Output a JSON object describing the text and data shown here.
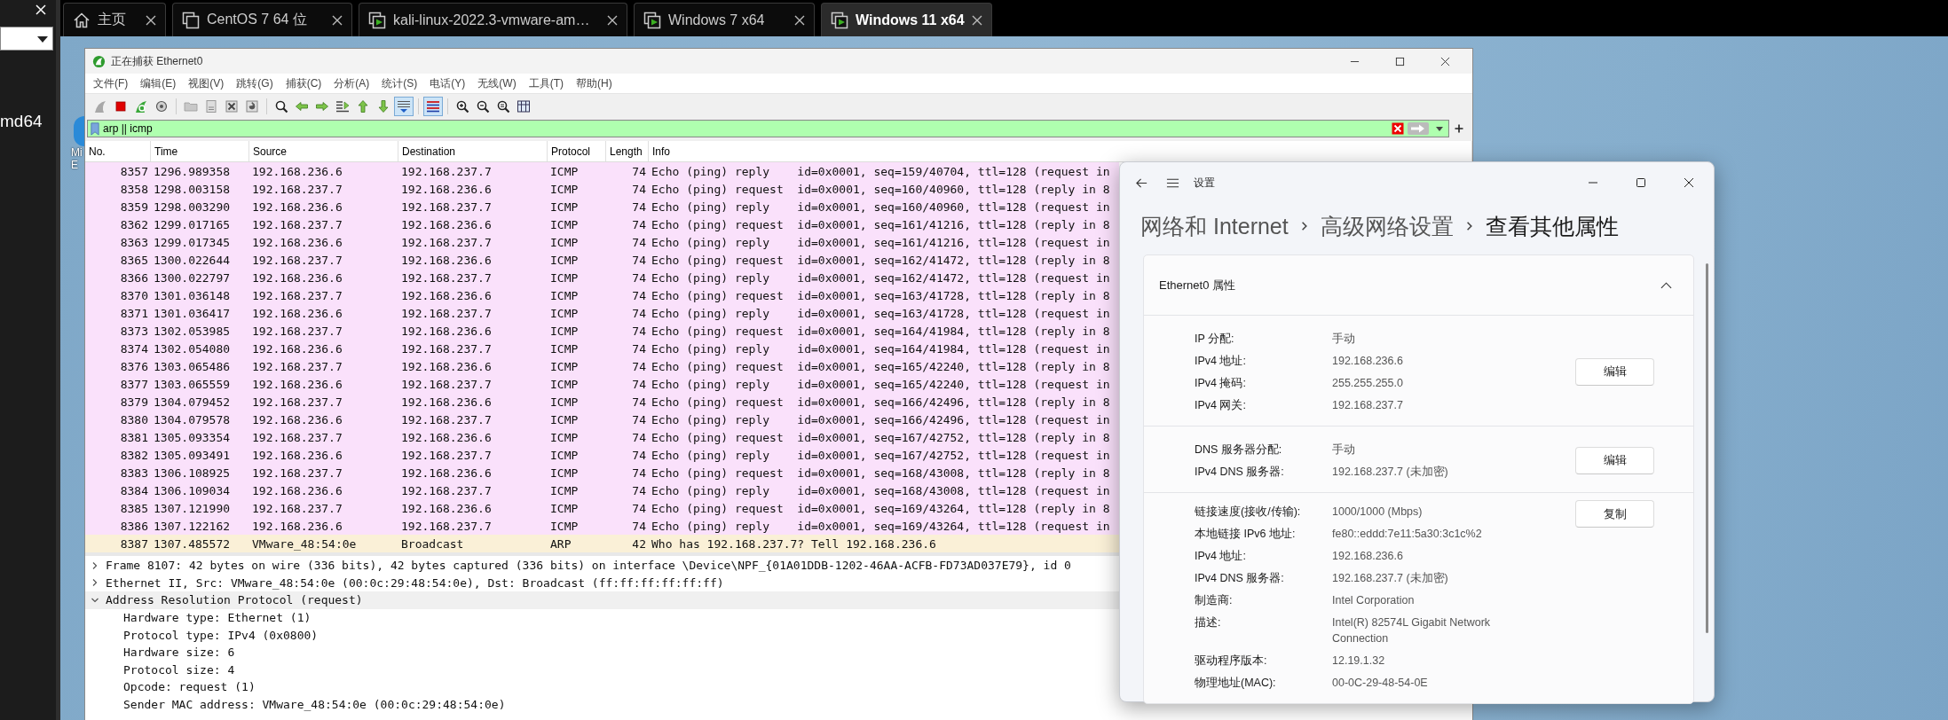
{
  "left_panel": {
    "label": "md64"
  },
  "browser_tabs": [
    {
      "label": "主页",
      "kind": "home",
      "selected": false
    },
    {
      "label": "CentOS 7 64 位",
      "kind": "vm",
      "selected": false
    },
    {
      "label": "kali-linux-2022.3-vmware-am…",
      "kind": "vm-running",
      "selected": false
    },
    {
      "label": "Windows 7 x64",
      "kind": "vm-running",
      "selected": false
    },
    {
      "label": "Windows 11 x64",
      "kind": "vm-running",
      "selected": true
    }
  ],
  "desktop_icon": {
    "label_lines": [
      "Mi",
      "E"
    ]
  },
  "wireshark": {
    "title": "正在捕获 Ethernet0",
    "menu": [
      "文件(F)",
      "编辑(E)",
      "视图(V)",
      "跳转(G)",
      "捕获(C)",
      "分析(A)",
      "统计(S)",
      "电话(Y)",
      "无线(W)",
      "工具(T)",
      "帮助(H)"
    ],
    "toolbar_buttons": [
      {
        "kind": "fin",
        "pressed": false
      },
      {
        "kind": "stop",
        "pressed": false
      },
      {
        "kind": "restart",
        "pressed": false
      },
      {
        "kind": "options",
        "pressed": false
      },
      {
        "kind": "open",
        "pressed": false
      },
      {
        "kind": "save",
        "pressed": false
      },
      {
        "kind": "close",
        "pressed": false
      },
      {
        "kind": "reload",
        "pressed": false
      },
      {
        "kind": "find",
        "pressed": false
      },
      {
        "kind": "back",
        "pressed": false
      },
      {
        "kind": "forward",
        "pressed": false
      },
      {
        "kind": "jump",
        "pressed": false
      },
      {
        "kind": "first",
        "pressed": false
      },
      {
        "kind": "last",
        "pressed": false
      },
      {
        "kind": "autoscroll",
        "pressed": true
      },
      {
        "kind": "colorize",
        "pressed": true
      },
      {
        "kind": "zoom-in",
        "pressed": false
      },
      {
        "kind": "zoom-out",
        "pressed": false
      },
      {
        "kind": "zoom-reset",
        "pressed": false
      },
      {
        "kind": "resize",
        "pressed": false
      }
    ],
    "filter": {
      "value": "arp || icmp"
    },
    "packet_list": {
      "columns": [
        "No.",
        "Time",
        "Source",
        "Destination",
        "Protocol",
        "Length",
        "Info"
      ],
      "rows": [
        {
          "no": "8357",
          "time": "1296.989358",
          "source": "192.168.236.6",
          "destination": "192.168.237.7",
          "protocol": "ICMP",
          "length": "74",
          "info": "Echo (ping) reply    id=0x0001, seq=159/40704, ttl=128 (request in",
          "kind": "icmp"
        },
        {
          "no": "8358",
          "time": "1298.003158",
          "source": "192.168.237.7",
          "destination": "192.168.236.6",
          "protocol": "ICMP",
          "length": "74",
          "info": "Echo (ping) request  id=0x0001, seq=160/40960, ttl=128 (reply in 8",
          "kind": "icmp"
        },
        {
          "no": "8359",
          "time": "1298.003290",
          "source": "192.168.236.6",
          "destination": "192.168.237.7",
          "protocol": "ICMP",
          "length": "74",
          "info": "Echo (ping) reply    id=0x0001, seq=160/40960, ttl=128 (request in",
          "kind": "icmp"
        },
        {
          "no": "8362",
          "time": "1299.017165",
          "source": "192.168.237.7",
          "destination": "192.168.236.6",
          "protocol": "ICMP",
          "length": "74",
          "info": "Echo (ping) request  id=0x0001, seq=161/41216, ttl=128 (reply in 8",
          "kind": "icmp"
        },
        {
          "no": "8363",
          "time": "1299.017345",
          "source": "192.168.236.6",
          "destination": "192.168.237.7",
          "protocol": "ICMP",
          "length": "74",
          "info": "Echo (ping) reply    id=0x0001, seq=161/41216, ttl=128 (request in",
          "kind": "icmp"
        },
        {
          "no": "8365",
          "time": "1300.022644",
          "source": "192.168.237.7",
          "destination": "192.168.236.6",
          "protocol": "ICMP",
          "length": "74",
          "info": "Echo (ping) request  id=0x0001, seq=162/41472, ttl=128 (reply in 8",
          "kind": "icmp"
        },
        {
          "no": "8366",
          "time": "1300.022797",
          "source": "192.168.236.6",
          "destination": "192.168.237.7",
          "protocol": "ICMP",
          "length": "74",
          "info": "Echo (ping) reply    id=0x0001, seq=162/41472, ttl=128 (request in",
          "kind": "icmp"
        },
        {
          "no": "8370",
          "time": "1301.036148",
          "source": "192.168.237.7",
          "destination": "192.168.236.6",
          "protocol": "ICMP",
          "length": "74",
          "info": "Echo (ping) request  id=0x0001, seq=163/41728, ttl=128 (reply in 8",
          "kind": "icmp"
        },
        {
          "no": "8371",
          "time": "1301.036417",
          "source": "192.168.236.6",
          "destination": "192.168.237.7",
          "protocol": "ICMP",
          "length": "74",
          "info": "Echo (ping) reply    id=0x0001, seq=163/41728, ttl=128 (request in",
          "kind": "icmp"
        },
        {
          "no": "8373",
          "time": "1302.053985",
          "source": "192.168.237.7",
          "destination": "192.168.236.6",
          "protocol": "ICMP",
          "length": "74",
          "info": "Echo (ping) request  id=0x0001, seq=164/41984, ttl=128 (reply in 8",
          "kind": "icmp"
        },
        {
          "no": "8374",
          "time": "1302.054080",
          "source": "192.168.236.6",
          "destination": "192.168.237.7",
          "protocol": "ICMP",
          "length": "74",
          "info": "Echo (ping) reply    id=0x0001, seq=164/41984, ttl=128 (request in",
          "kind": "icmp"
        },
        {
          "no": "8376",
          "time": "1303.065486",
          "source": "192.168.237.7",
          "destination": "192.168.236.6",
          "protocol": "ICMP",
          "length": "74",
          "info": "Echo (ping) request  id=0x0001, seq=165/42240, ttl=128 (reply in 8",
          "kind": "icmp"
        },
        {
          "no": "8377",
          "time": "1303.065559",
          "source": "192.168.236.6",
          "destination": "192.168.237.7",
          "protocol": "ICMP",
          "length": "74",
          "info": "Echo (ping) reply    id=0x0001, seq=165/42240, ttl=128 (request in",
          "kind": "icmp"
        },
        {
          "no": "8379",
          "time": "1304.079452",
          "source": "192.168.237.7",
          "destination": "192.168.236.6",
          "protocol": "ICMP",
          "length": "74",
          "info": "Echo (ping) request  id=0x0001, seq=166/42496, ttl=128 (reply in 8",
          "kind": "icmp"
        },
        {
          "no": "8380",
          "time": "1304.079578",
          "source": "192.168.236.6",
          "destination": "192.168.237.7",
          "protocol": "ICMP",
          "length": "74",
          "info": "Echo (ping) reply    id=0x0001, seq=166/42496, ttl=128 (request in",
          "kind": "icmp"
        },
        {
          "no": "8381",
          "time": "1305.093354",
          "source": "192.168.237.7",
          "destination": "192.168.236.6",
          "protocol": "ICMP",
          "length": "74",
          "info": "Echo (ping) request  id=0x0001, seq=167/42752, ttl=128 (reply in 8",
          "kind": "icmp"
        },
        {
          "no": "8382",
          "time": "1305.093491",
          "source": "192.168.236.6",
          "destination": "192.168.237.7",
          "protocol": "ICMP",
          "length": "74",
          "info": "Echo (ping) reply    id=0x0001, seq=167/42752, ttl=128 (request in",
          "kind": "icmp"
        },
        {
          "no": "8383",
          "time": "1306.108925",
          "source": "192.168.237.7",
          "destination": "192.168.236.6",
          "protocol": "ICMP",
          "length": "74",
          "info": "Echo (ping) request  id=0x0001, seq=168/43008, ttl=128 (reply in 8",
          "kind": "icmp"
        },
        {
          "no": "8384",
          "time": "1306.109034",
          "source": "192.168.236.6",
          "destination": "192.168.237.7",
          "protocol": "ICMP",
          "length": "74",
          "info": "Echo (ping) reply    id=0x0001, seq=168/43008, ttl=128 (request in",
          "kind": "icmp"
        },
        {
          "no": "8385",
          "time": "1307.121990",
          "source": "192.168.237.7",
          "destination": "192.168.236.6",
          "protocol": "ICMP",
          "length": "74",
          "info": "Echo (ping) request  id=0x0001, seq=169/43264, ttl=128 (reply in 8",
          "kind": "icmp"
        },
        {
          "no": "8386",
          "time": "1307.122162",
          "source": "192.168.236.6",
          "destination": "192.168.237.7",
          "protocol": "ICMP",
          "length": "74",
          "info": "Echo (ping) reply    id=0x0001, seq=169/43264, ttl=128 (request in",
          "kind": "icmp"
        },
        {
          "no": "8387",
          "time": "1307.485572",
          "source": "VMware_48:54:0e",
          "destination": "Broadcast",
          "protocol": "ARP",
          "length": "42",
          "info": "Who has 192.168.237.7? Tell 192.168.236.6",
          "kind": "arp"
        }
      ]
    },
    "details": [
      {
        "text": "Frame 8107: 42 bytes on wire (336 bits), 42 bytes captured (336 bits) on interface \\Device\\NPF_{01A01DDB-1202-46AA-ACFB-FD73AD037E79}, id 0",
        "expanded": false,
        "selected": false
      },
      {
        "text": "Ethernet II, Src: VMware_48:54:0e (00:0c:29:48:54:0e), Dst: Broadcast (ff:ff:ff:ff:ff:ff)",
        "expanded": false,
        "selected": false
      },
      {
        "text": "Address Resolution Protocol (request)",
        "expanded": true,
        "selected": true,
        "children": [
          {
            "text": "Hardware type: Ethernet (1)"
          },
          {
            "text": "Protocol type: IPv4 (0x0800)"
          },
          {
            "text": "Hardware size: 6"
          },
          {
            "text": "Protocol size: 4"
          },
          {
            "text": "Opcode: request (1)"
          },
          {
            "text": "Sender MAC address: VMware_48:54:0e (00:0c:29:48:54:0e)"
          }
        ]
      }
    ]
  },
  "settings": {
    "title": "设置",
    "breadcrumb": [
      "网络和 Internet",
      "高级网络设置",
      "查看其他属性"
    ],
    "card": {
      "title": "Ethernet0 属性",
      "expanded": true,
      "sections": [
        {
          "button": "编辑",
          "rows": [
            {
              "label": "IP 分配:",
              "value": "手动"
            },
            {
              "label": "IPv4 地址:",
              "value": "192.168.236.6"
            },
            {
              "label": "IPv4 掩码:",
              "value": "255.255.255.0"
            },
            {
              "label": "IPv4 网关:",
              "value": "192.168.237.7"
            }
          ]
        },
        {
          "button": "编辑",
          "rows": [
            {
              "label": "DNS 服务器分配:",
              "value": "手动"
            },
            {
              "label": "IPv4 DNS 服务器:",
              "value": "192.168.237.7 (未加密)"
            }
          ]
        },
        {
          "button": "复制",
          "rows": [
            {
              "label": "链接速度(接收/传输):",
              "value": "1000/1000 (Mbps)"
            },
            {
              "label": "本地链接 IPv6 地址:",
              "value": "fe80::eddd:7e11:5a30:3c1c%2"
            },
            {
              "label": "IPv4 地址:",
              "value": "192.168.236.6"
            },
            {
              "label": "IPv4 DNS 服务器:",
              "value": "192.168.237.7 (未加密)"
            },
            {
              "label": "制造商:",
              "value": "Intel Corporation"
            },
            {
              "label": "描述:",
              "value": "Intel(R) 82574L Gigabit Network Connection"
            },
            {
              "label": "驱动程序版本:",
              "value": "12.19.1.32"
            },
            {
              "label": "物理地址(MAC):",
              "value": "00-0C-29-48-54-0E"
            }
          ]
        }
      ]
    }
  }
}
